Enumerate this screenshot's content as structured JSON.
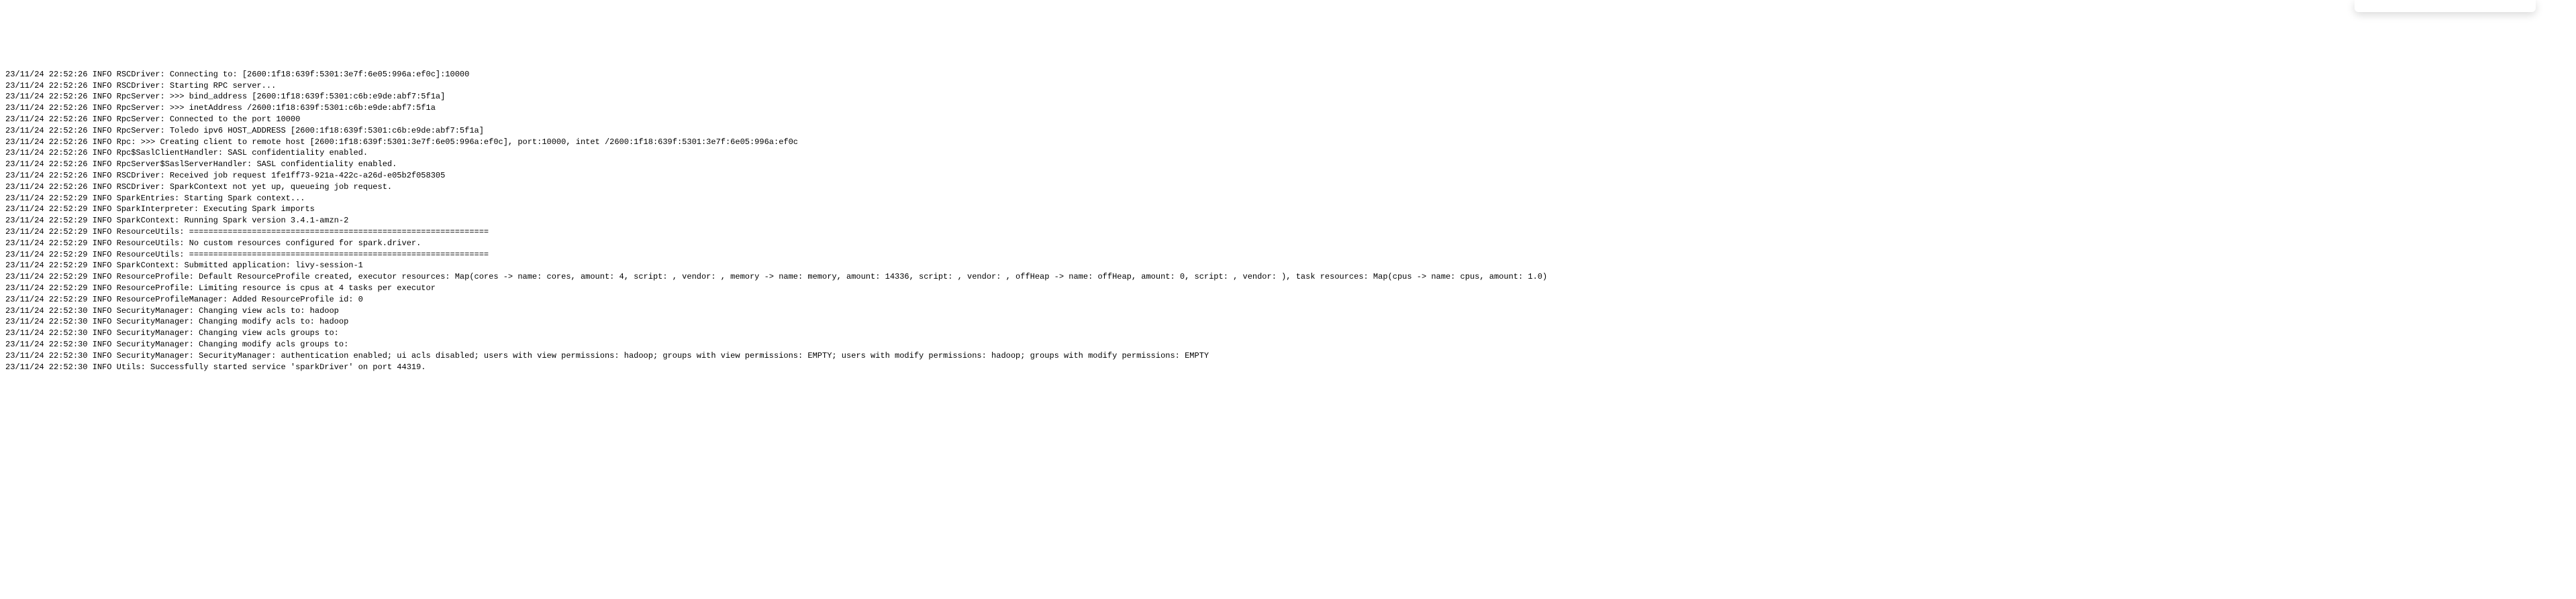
{
  "log_lines": [
    "23/11/24 22:52:26 INFO RSCDriver: Connecting to: [2600:1f18:639f:5301:3e7f:6e05:996a:ef0c]:10000",
    "23/11/24 22:52:26 INFO RSCDriver: Starting RPC server...",
    "23/11/24 22:52:26 INFO RpcServer: >>> bind_address [2600:1f18:639f:5301:c6b:e9de:abf7:5f1a]",
    "23/11/24 22:52:26 INFO RpcServer: >>> inetAddress /2600:1f18:639f:5301:c6b:e9de:abf7:5f1a",
    "23/11/24 22:52:26 INFO RpcServer: Connected to the port 10000",
    "23/11/24 22:52:26 INFO RpcServer: Toledo ipv6 HOST_ADDRESS [2600:1f18:639f:5301:c6b:e9de:abf7:5f1a]",
    "23/11/24 22:52:26 INFO Rpc: >>> Creating client to remote host [2600:1f18:639f:5301:3e7f:6e05:996a:ef0c], port:10000, intet /2600:1f18:639f:5301:3e7f:6e05:996a:ef0c",
    "23/11/24 22:52:26 INFO Rpc$SaslClientHandler: SASL confidentiality enabled.",
    "23/11/24 22:52:26 INFO RpcServer$SaslServerHandler: SASL confidentiality enabled.",
    "23/11/24 22:52:26 INFO RSCDriver: Received job request 1fe1ff73-921a-422c-a26d-e05b2f058305",
    "23/11/24 22:52:26 INFO RSCDriver: SparkContext not yet up, queueing job request.",
    "23/11/24 22:52:29 INFO SparkEntries: Starting Spark context...",
    "23/11/24 22:52:29 INFO SparkInterpreter: Executing Spark imports",
    "23/11/24 22:52:29 INFO SparkContext: Running Spark version 3.4.1-amzn-2",
    "23/11/24 22:52:29 INFO ResourceUtils: ==============================================================",
    "23/11/24 22:52:29 INFO ResourceUtils: No custom resources configured for spark.driver.",
    "23/11/24 22:52:29 INFO ResourceUtils: ==============================================================",
    "23/11/24 22:52:29 INFO SparkContext: Submitted application: livy-session-1",
    "23/11/24 22:52:29 INFO ResourceProfile: Default ResourceProfile created, executor resources: Map(cores -> name: cores, amount: 4, script: , vendor: , memory -> name: memory, amount: 14336, script: , vendor: , offHeap -> name: offHeap, amount: 0, script: , vendor: ), task resources: Map(cpus -> name: cpus, amount: 1.0)",
    "23/11/24 22:52:29 INFO ResourceProfile: Limiting resource is cpus at 4 tasks per executor",
    "23/11/24 22:52:29 INFO ResourceProfileManager: Added ResourceProfile id: 0",
    "23/11/24 22:52:30 INFO SecurityManager: Changing view acls to: hadoop",
    "23/11/24 22:52:30 INFO SecurityManager: Changing modify acls to: hadoop",
    "23/11/24 22:52:30 INFO SecurityManager: Changing view acls groups to:",
    "23/11/24 22:52:30 INFO SecurityManager: Changing modify acls groups to:",
    "23/11/24 22:52:30 INFO SecurityManager: SecurityManager: authentication enabled; ui acls disabled; users with view permissions: hadoop; groups with view permissions: EMPTY; users with modify permissions: hadoop; groups with modify permissions: EMPTY",
    "23/11/24 22:52:30 INFO Utils: Successfully started service 'sparkDriver' on port 44319."
  ]
}
